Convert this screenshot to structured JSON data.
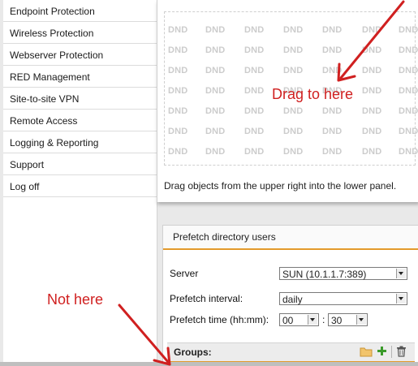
{
  "sidebar": {
    "items": [
      {
        "label": "Endpoint Protection"
      },
      {
        "label": "Wireless Protection"
      },
      {
        "label": "Webserver Protection"
      },
      {
        "label": "RED Management"
      },
      {
        "label": "Site-to-site VPN"
      },
      {
        "label": "Remote Access"
      },
      {
        "label": "Logging & Reporting"
      },
      {
        "label": "Support"
      },
      {
        "label": "Log off"
      }
    ]
  },
  "drop_panel": {
    "placeholder_text": "DND",
    "hint": "Drag objects from the upper right into the lower panel."
  },
  "prefetch": {
    "title": "Prefetch directory users",
    "server_label": "Server",
    "server_value": "SUN (10.1.1.7:389)",
    "interval_label": "Prefetch interval:",
    "interval_value": "daily",
    "time_label": "Prefetch time (hh:mm):",
    "hour_value": "00",
    "time_separator": ":",
    "minute_value": "30",
    "groups_label": "Groups:"
  },
  "annotations": {
    "good_target": "Drag to here",
    "bad_target": "Not here"
  },
  "colors": {
    "accent": "#e39a2b",
    "annotation": "#d02020",
    "dnd_watermark": "#cccccc"
  }
}
